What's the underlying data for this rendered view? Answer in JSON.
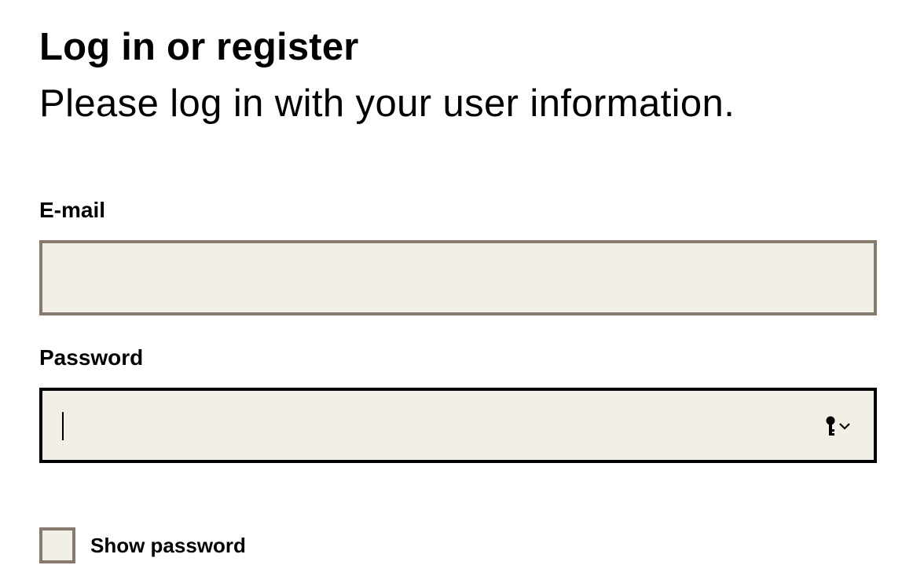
{
  "header": {
    "title": "Log in or register",
    "subtitle": "Please log in with your user information."
  },
  "form": {
    "email": {
      "label": "E-mail",
      "value": "",
      "placeholder": ""
    },
    "password": {
      "label": "Password",
      "value": "",
      "placeholder": "",
      "focused": true,
      "autofill_icon": "key-icon"
    },
    "show_password": {
      "label": "Show password",
      "checked": false
    }
  },
  "colors": {
    "input_background": "#f2efe7",
    "input_border": "#857a6d",
    "focused_border": "#000000",
    "text": "#000000"
  }
}
